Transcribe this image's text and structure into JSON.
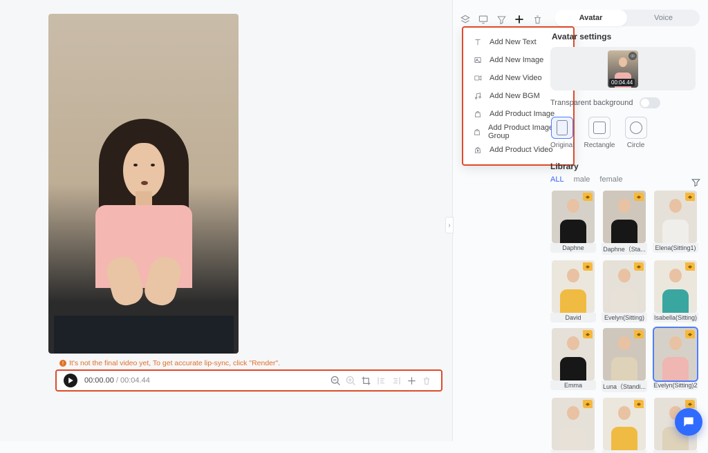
{
  "toolbar_icons": [
    "layers",
    "cast",
    "filter",
    "plus",
    "trash"
  ],
  "add_menu": [
    {
      "icon": "text",
      "label": "Add New Text"
    },
    {
      "icon": "image",
      "label": "Add New Image"
    },
    {
      "icon": "video",
      "label": "Add New Video"
    },
    {
      "icon": "music",
      "label": "Add New BGM"
    },
    {
      "icon": "bag",
      "label": "Add Product Image"
    },
    {
      "icon": "bag",
      "label": "Add Product Image Group"
    },
    {
      "icon": "bag-play",
      "label": "Add Product Video"
    }
  ],
  "tabs": {
    "avatar": "Avatar",
    "voice": "Voice"
  },
  "avatar_settings": {
    "title": "Avatar settings",
    "duration_badge": "00:04.44",
    "transparent_bg_label": "Transparent background",
    "shapes": {
      "original": "Original",
      "rectangle": "Rectangle",
      "circle": "Circle"
    }
  },
  "library": {
    "title": "Library",
    "filters": {
      "all": "ALL",
      "male": "male",
      "female": "female"
    },
    "avatars": [
      {
        "name": "Daphne",
        "tag": true,
        "cls": "c-black bg-a"
      },
      {
        "name": "Daphne（Sta...",
        "tag": true,
        "cls": "c-black bg-b"
      },
      {
        "name": "Elena(Sitting1)",
        "tag": true,
        "cls": "c-white bg-c"
      },
      {
        "name": "David",
        "tag": true,
        "cls": "c-yellow bg-d"
      },
      {
        "name": "Evelyn(Sitting)",
        "tag": true,
        "cls": "c-off bg-c"
      },
      {
        "name": "Isabella(Sitting)",
        "tag": true,
        "cls": "c-teal bg-d"
      },
      {
        "name": "Emma",
        "tag": true,
        "cls": "c-black bg-c"
      },
      {
        "name": "Luna（Standi...",
        "tag": true,
        "cls": "c-beige bg-b"
      },
      {
        "name": "Evelyn(Sitting)2",
        "tag": true,
        "cls": "c-pink bg-a",
        "selected": true
      },
      {
        "name": "",
        "tag": true,
        "cls": "c-off bg-c"
      },
      {
        "name": "",
        "tag": true,
        "cls": "c-yellow bg-d"
      },
      {
        "name": "",
        "tag": true,
        "cls": "c-beige bg-c"
      }
    ]
  },
  "timeline": {
    "notice": "It's not the final video yet, To get accurate lip-sync, click \"Render\".",
    "current": "00:00.00",
    "separator": "/",
    "duration": "00:04.44"
  }
}
